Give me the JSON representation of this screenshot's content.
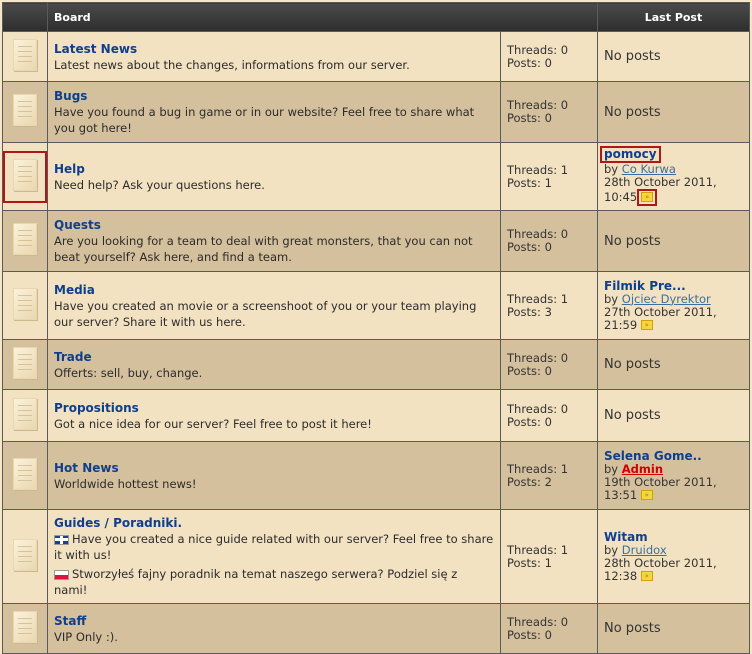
{
  "header": {
    "board_label": "Board",
    "last_post_label": "Last Post"
  },
  "boards": [
    {
      "title": "Latest News",
      "description": "Latest news about the changes, informations from our server.",
      "threads": "Threads: 0",
      "posts": "Posts: 0",
      "last_post": {
        "none": "No posts"
      }
    },
    {
      "title": "Bugs",
      "description": "Have you found a bug in game or in our website? Feel free to share what you got here!",
      "threads": "Threads: 0",
      "posts": "Posts: 0",
      "last_post": {
        "none": "No posts"
      }
    },
    {
      "title": "Help",
      "description": "Need help? Ask your questions here.",
      "threads": "Threads: 1",
      "posts": "Posts: 1",
      "last_post": {
        "title": "pomocy",
        "by": "by",
        "user": "Co Kurwa",
        "date": "28th October 2011,",
        "time": "10:45"
      }
    },
    {
      "title": "Quests",
      "description": "Are you looking for a team to deal with great monsters, that you can not beat yourself? Ask here, and find a team.",
      "threads": "Threads: 0",
      "posts": "Posts: 0",
      "last_post": {
        "none": "No posts"
      }
    },
    {
      "title": "Media",
      "description": "Have you created an movie or a screenshoot of you or your team playing our server? Share it with us here.",
      "threads": "Threads: 1",
      "posts": "Posts: 3",
      "last_post": {
        "title": "Filmik Pre...",
        "by": "by",
        "user": "Ojciec Dyrektor",
        "date": "27th October 2011,",
        "time": "21:59"
      }
    },
    {
      "title": "Trade",
      "description": "Offerts: sell, buy, change.",
      "threads": "Threads: 0",
      "posts": "Posts: 0",
      "last_post": {
        "none": "No posts"
      }
    },
    {
      "title": "Propositions",
      "description": "Got a nice idea for our server? Feel free to post it here!",
      "threads": "Threads: 0",
      "posts": "Posts: 0",
      "last_post": {
        "none": "No posts"
      }
    },
    {
      "title": "Hot News",
      "description": "Worldwide hottest news!",
      "threads": "Threads: 1",
      "posts": "Posts: 2",
      "last_post": {
        "title": "Selena Gome..",
        "by": "by",
        "user": "Admin",
        "date": "19th October 2011,",
        "time": "13:51"
      }
    },
    {
      "title": "Guides / Poradniki.",
      "description_en": "Have you created a nice guide related with our server? Feel free to share it with us!",
      "description_pl": "Stworzyłeś fajny poradnik na temat naszego serwera? Podziel się z nami!",
      "threads": "Threads: 1",
      "posts": "Posts: 1",
      "last_post": {
        "title": "Witam",
        "by": "by",
        "user": "Druidox",
        "date": "28th October 2011,",
        "time": "12:38"
      }
    },
    {
      "title": "Staff",
      "description": "VIP Only :).",
      "threads": "Threads: 0",
      "posts": "Posts: 0",
      "last_post": {
        "none": "No posts"
      }
    }
  ]
}
